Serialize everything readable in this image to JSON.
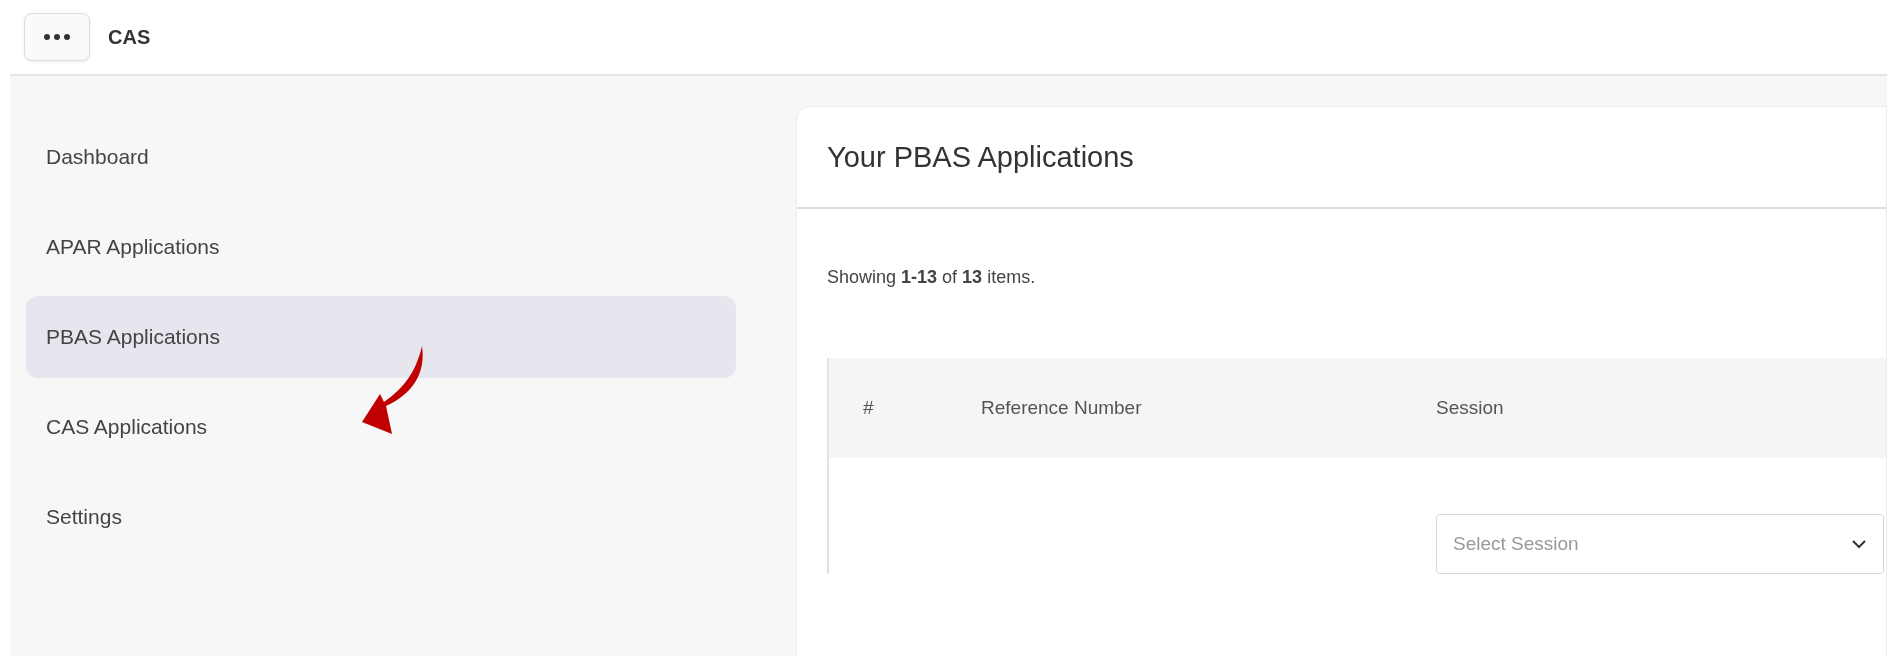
{
  "header": {
    "title": "CAS"
  },
  "sidebar": {
    "items": [
      {
        "label": "Dashboard",
        "selected": false
      },
      {
        "label": "APAR Applications",
        "selected": false
      },
      {
        "label": "PBAS Applications",
        "selected": true
      },
      {
        "label": "CAS Applications",
        "selected": false
      },
      {
        "label": "Settings",
        "selected": false
      }
    ]
  },
  "card": {
    "title": "Your PBAS Applications",
    "summary": "Showing **1-13** of **13** items.",
    "table": {
      "columns": [
        "#",
        "Reference Number",
        "Session"
      ],
      "filters": [
        {
          "kind": "none"
        },
        {
          "kind": "none"
        },
        {
          "kind": "select",
          "placeholder": "Select Session"
        }
      ]
    }
  }
}
